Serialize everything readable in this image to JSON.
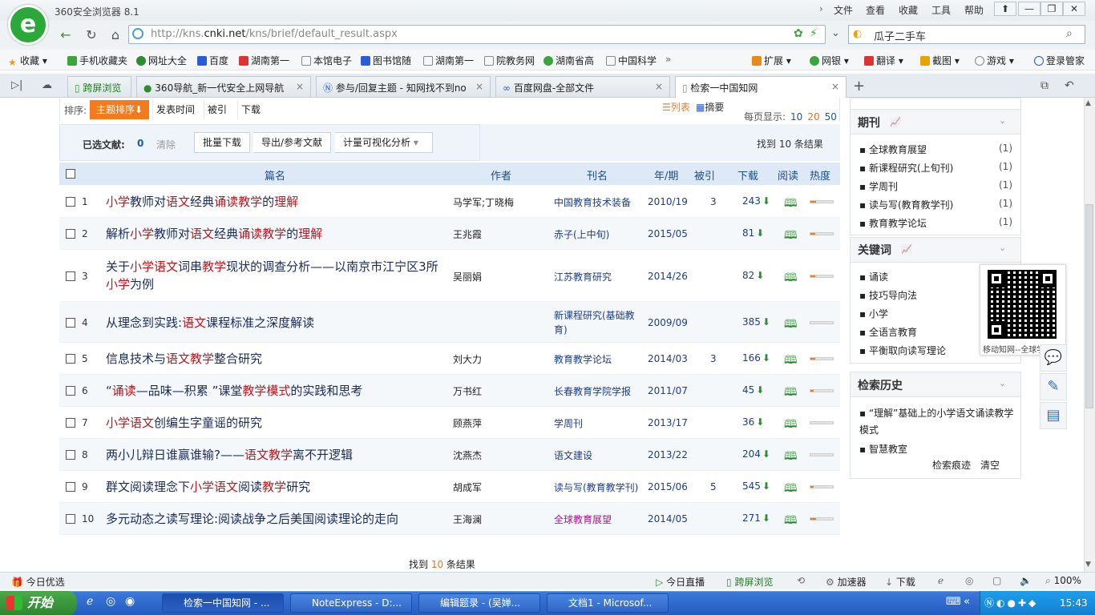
{
  "app": {
    "title": "360安全浏览器 8.1"
  },
  "menu": [
    "文件",
    "查看",
    "收藏",
    "工具",
    "帮助"
  ],
  "address": {
    "prefix": "http://kns.",
    "domain": "cnki.net",
    "path": "/kns/brief/default_result.aspx"
  },
  "search": {
    "value": "瓜子二手车"
  },
  "bookmarks": [
    "收藏",
    "手机收藏夹",
    "网址大全",
    "百度",
    "湖南第一",
    "本馆电子",
    "图书馆随",
    "湖南第一",
    "院教务网",
    "湖南省高",
    "中国科学"
  ],
  "toolbar_right": [
    "扩展",
    "网银",
    "翻译",
    "截图",
    "游戏",
    "登录管家"
  ],
  "tabs": [
    {
      "label": "跨屏浏览"
    },
    {
      "label": "360导航_新一代安全上网导航"
    },
    {
      "label": "参与/回复主题 - 知网找不到no"
    },
    {
      "label": "百度网盘-全部文件"
    },
    {
      "label": "检索一中国知网"
    }
  ],
  "sort": {
    "label": "排序:",
    "active": "主题排序",
    "options": [
      "发表时间",
      "被引",
      "下载"
    ],
    "view_list": "列表",
    "view_abstract": "摘要"
  },
  "perpage": {
    "label": "每页显示:",
    "options": [
      "10",
      "20",
      "50"
    ],
    "current": "20"
  },
  "selection": {
    "label": "已选文献:",
    "count": "0",
    "clear": "清除",
    "buttons": [
      "批量下载",
      "导出/参考文献",
      "计量可视化分析"
    ],
    "found": "找到 10 条结果"
  },
  "columns": [
    "篇名",
    "作者",
    "刊名",
    "年/期",
    "被引",
    "下载",
    "阅读",
    "热度"
  ],
  "rows": [
    {
      "n": "1",
      "author": "马学军;丁晓梅",
      "journal": "中国教育技术装备",
      "date": "2010/19",
      "cite": "3",
      "dl": "243",
      "heat": 0.25
    },
    {
      "n": "2",
      "author": "王兆霞",
      "journal": "赤子(上中旬)",
      "date": "2015/05",
      "cite": "",
      "dl": "81",
      "heat": 0.2
    },
    {
      "n": "3",
      "author": "吴丽娟",
      "journal": "江苏教育研究",
      "date": "2014/26",
      "cite": "",
      "dl": "82",
      "heat": 0.2
    },
    {
      "n": "4",
      "author": "",
      "journal": "新课程研究(基础教育)",
      "date": "2009/09",
      "cite": "",
      "dl": "385",
      "heat": 0.0
    },
    {
      "n": "5",
      "author": "刘大力",
      "journal": "教育教学论坛",
      "date": "2014/03",
      "cite": "3",
      "dl": "166",
      "heat": 0.2
    },
    {
      "n": "6",
      "author": "万书红",
      "journal": "长春教育学院学报",
      "date": "2011/07",
      "cite": "",
      "dl": "45",
      "heat": 0.15
    },
    {
      "n": "7",
      "author": "顾燕萍",
      "journal": "学周刊",
      "date": "2013/17",
      "cite": "",
      "dl": "36",
      "heat": 0.0
    },
    {
      "n": "8",
      "author": "沈燕杰",
      "journal": "语文建设",
      "date": "2013/22",
      "cite": "",
      "dl": "204",
      "heat": 0.0
    },
    {
      "n": "9",
      "author": "胡成军",
      "journal": "读与写(教育教学刊)",
      "date": "2015/06",
      "cite": "5",
      "dl": "545",
      "heat": 0.15
    },
    {
      "n": "10",
      "author": "王海澜",
      "journal": "全球教育展望",
      "date": "2014/05",
      "cite": "",
      "dl": "271",
      "heat": 0.25
    }
  ],
  "found_bottom": {
    "prefix": "找到 ",
    "count": "10",
    "suffix": " 条结果"
  },
  "sidebar": {
    "journals_title": "期刊",
    "journals": [
      {
        "name": "全球教育展望",
        "count": "(1)"
      },
      {
        "name": "新课程研究(上旬刊)",
        "count": "(1)"
      },
      {
        "name": "学周刊",
        "count": "(1)"
      },
      {
        "name": "读与写(教育教学刊)",
        "count": "(1)"
      },
      {
        "name": "教育教学论坛",
        "count": "(1)"
      }
    ],
    "keywords_title": "关键词",
    "keywords": [
      "诵读",
      "技巧导向法",
      "小学",
      "全语言教育",
      "平衡取向读写理论"
    ],
    "qr_caption": "移动知网--全球学",
    "history_title": "检索历史",
    "history": [
      "“理解”基础上的小学语文诵读教学模式",
      "智慧教室"
    ],
    "history_links": [
      "检索痕迹",
      "清空"
    ]
  },
  "status": {
    "left": "今日优选",
    "items": [
      "今日直播",
      "跨屏浏览",
      "加速器",
      "下载"
    ],
    "zoom": "100%"
  },
  "taskbar": {
    "start": "开始",
    "tasks": [
      "检索一中国知网 - ...",
      "NoteExpress - D:...",
      "编辑题录 - (吴婵...",
      "文档1 - Microsof..."
    ],
    "clock": "15:43"
  }
}
